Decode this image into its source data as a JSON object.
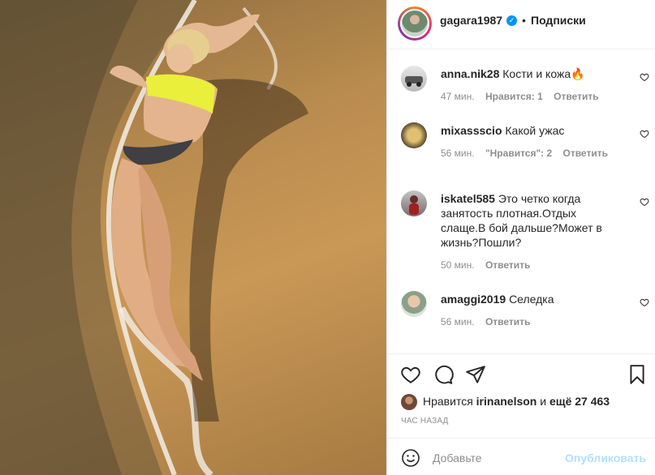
{
  "post": {
    "username": "gagara1987",
    "dot": "•",
    "follow_label": "Подписки",
    "photo_alt": ""
  },
  "comments": [
    {
      "user": "anna.nik28",
      "text": "Кости и кожа🔥",
      "time": "47 мин.",
      "likes": "Нравится: 1",
      "reply": "Ответить"
    },
    {
      "user": "mixassscio",
      "text": "Какой ужас",
      "time": "56 мин.",
      "likes": "\"Нравится\": 2",
      "reply": "Ответить"
    },
    {
      "user": "iskatel585",
      "text": "Это четко когда занятость плотная.Отдых слаще.В бой дальше?Может в жизнь?Пошли?",
      "time": "50 мин.",
      "likes": "",
      "reply": "Ответить"
    },
    {
      "user": "amaggi2019",
      "text": "Селедка",
      "time": "56 мин.",
      "likes": "",
      "reply": "Ответить"
    }
  ],
  "actions": {
    "liked_prefix": "Нравится",
    "liked_user": "irinanelson",
    "liked_suffix": " и ",
    "liked_more": "ещё 27 463",
    "time_ago": "ЧАС НАЗАД"
  },
  "composer": {
    "placeholder": "Добавьте",
    "publish": "Опубликовать"
  },
  "colors": {
    "verified": "#0095f6",
    "publish_disabled": "#b2dffc",
    "meta_gray": "#8e8e8e"
  }
}
